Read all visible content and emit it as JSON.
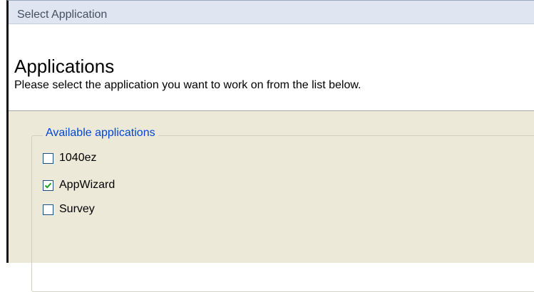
{
  "window": {
    "title": "Select Application"
  },
  "header": {
    "title": "Applications",
    "subtitle": "Please select the application you want to work on from the list below."
  },
  "group": {
    "legend": "Available applications",
    "items": [
      {
        "label": "1040ez",
        "checked": false
      },
      {
        "label": "AppWizard",
        "checked": true
      },
      {
        "label": "Survey",
        "checked": false
      }
    ]
  },
  "colors": {
    "legend_text": "#0046d5",
    "checkbox_border": "#1c5180",
    "checkmark": "#21a121",
    "dialog_background": "#ece9d8"
  }
}
